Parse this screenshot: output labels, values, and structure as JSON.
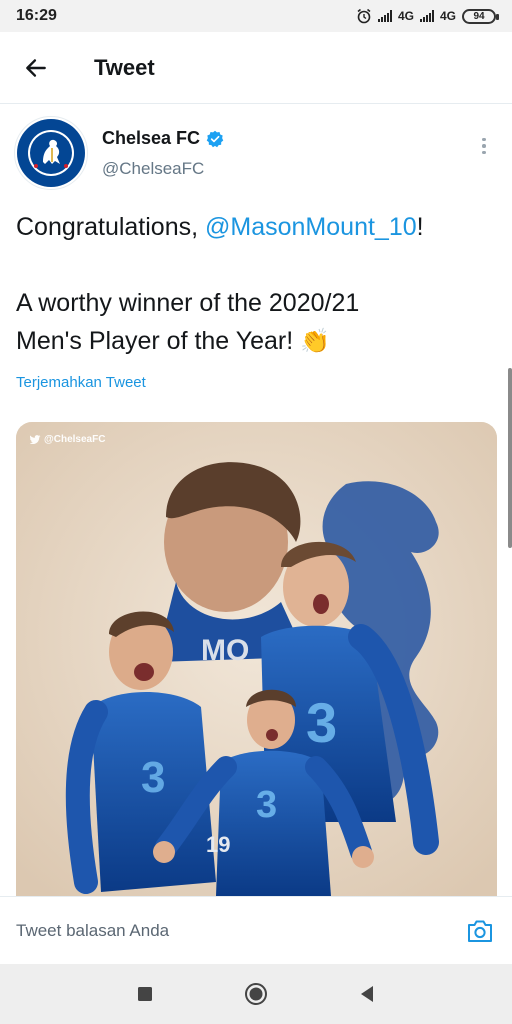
{
  "status_bar": {
    "time": "16:29",
    "network_1": "4G",
    "network_2": "4G",
    "battery": "94"
  },
  "header": {
    "title": "Tweet"
  },
  "tweet": {
    "author_name": "Chelsea FC",
    "author_handle": "@ChelseaFC",
    "verified": true,
    "avatar_text_top": "CHELSEA",
    "avatar_text_bottom": "FOOTBALL CLUB",
    "text_prefix": "Congratulations, ",
    "mention": "@MasonMount_10",
    "text_suffix": "!",
    "line_2": "A worthy winner of the 2020/21",
    "line_3": "Men's Player of the Year! ",
    "emoji": "👏",
    "translate_label": "Terjemahkan Tweet",
    "media": {
      "watermark": "@ChelseaFC",
      "shirt_name": "MO",
      "shirt_number": "19",
      "sponsor": "3"
    }
  },
  "reply": {
    "placeholder": "Tweet balasan Anda"
  },
  "colors": {
    "accent": "#1b95e0",
    "chelsea_blue": "#034694",
    "media_background": "#e8d9c6"
  },
  "icons": {
    "back": "arrow-left-icon",
    "verified": "verified-badge-icon",
    "more": "more-vertical-icon",
    "camera": "camera-icon",
    "nav_recent": "square-icon",
    "nav_home": "circle-icon",
    "nav_back": "triangle-back-icon"
  }
}
